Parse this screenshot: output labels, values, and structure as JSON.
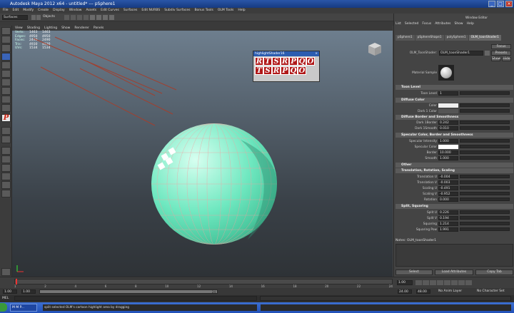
{
  "window": {
    "title": "Autodesk Maya 2012 x64 - untitled*   ---   pSphere1"
  },
  "menu": [
    "File",
    "Edit",
    "Modify",
    "Create",
    "Display",
    "Window",
    "Assets",
    "Edit Curves",
    "Surfaces",
    "Edit NURBS",
    "Subdiv Surfaces",
    "Bonus Tools",
    "OLM Tools",
    "Help"
  ],
  "status": {
    "mode": "Surfaces",
    "objects_label": "Objects"
  },
  "viewport": {
    "menu": [
      "View",
      "Shading",
      "Lighting",
      "Show",
      "Renderer",
      "Panels"
    ],
    "hud": [
      {
        "k": "Verts:",
        "v": "1463",
        "v2": "1463"
      },
      {
        "k": "Edges:",
        "v": "4950",
        "v2": "4950"
      },
      {
        "k": "Faces:",
        "v": "2490",
        "v2": "2490"
      },
      {
        "k": "Tris:",
        "v": "4930",
        "v2": "4930"
      },
      {
        "k": "UVs:",
        "v": "1534",
        "v2": "1534"
      }
    ],
    "axis_label": "persp"
  },
  "highlight_window": {
    "title": "highlightShader16",
    "row1": [
      "R",
      "T",
      "S",
      "R",
      "P",
      "Q",
      "O"
    ],
    "row2": [
      "T",
      "S",
      "R",
      "P",
      "Q",
      "O"
    ]
  },
  "attribute_editor": {
    "menu": [
      "List",
      "Selected",
      "Focus",
      "Attributes",
      "Show",
      "Help"
    ],
    "window_title": "Window Editor",
    "tabs": [
      "pSphere1",
      "pSphereShape1",
      "polySphere1",
      "OLM_toonShader1"
    ],
    "node_label": "OLM_ToonShader:",
    "node_value": "OLM_toonShader1",
    "focus_btn": "Focus",
    "presets_btn": "Presets",
    "show_btn": "Show",
    "hide_btn": "Hide",
    "material_sample": "Material Sample",
    "sections": {
      "toon_level": "Toon Level",
      "toon_level_label": "Toon Level",
      "toon_level_value": "1",
      "diffuse": "Diffuse Color",
      "color_label": "Color",
      "dark_color_label": "Dark 1 Color",
      "border": "Diffuse Border and Smoothness",
      "dark_border_label": "Dark 1Border",
      "dark_border_value": "0.242",
      "dark_smooth_label": "Dark 1Smooth",
      "dark_smooth_value": "0.010",
      "specular": "Specular Color, Border and Smoothness",
      "spec_int_label": "Specular Intensity",
      "spec_int_value": "1.000",
      "spec_color_label": "Specular Color",
      "spec_border_label": "Border",
      "spec_border_value": "10.000",
      "spec_smooth_label": "Smooth",
      "spec_smooth_value": "1.000",
      "other": "Other",
      "trs": "Translation, Rotation, Scaling",
      "tu_label": "Translation U",
      "tu_value": "-0.004",
      "tv_label": "Translation V",
      "tv_value": "-0.003",
      "su_label": "Scaling U",
      "su_value": "-0.491",
      "sv_label": "Scaling V",
      "sv_value": "-0.952",
      "rot_label": "Rotation",
      "rot_value": "0.000",
      "split": "Split, Squaring",
      "splitu_label": "Split U",
      "splitu_value": "0.226",
      "splitv_label": "Split V",
      "splitv_value": "0.194",
      "sq_label": "Squaring",
      "sq_value": "1.214",
      "sqp_label": "Squaring Pow",
      "sqp_value": "1.991",
      "notes": "Notes: OLM_toonShader1"
    },
    "buttons": [
      "Select",
      "Load Attributes",
      "Copy Tab"
    ]
  },
  "timeline": {
    "start": "1",
    "end": "24",
    "ticks": [
      "2",
      "4",
      "6",
      "8",
      "10",
      "12",
      "14",
      "16",
      "18",
      "20",
      "22",
      "24"
    ],
    "current": "1.00"
  },
  "range": {
    "start": "1.00",
    "inner_start": "1.00",
    "inner_end": "24",
    "end_a": "24.00",
    "end_b": "48.00",
    "anim_layer": "No Anim Layer",
    "char_set": "No Character Set"
  },
  "cmd": {
    "label": "MEL"
  },
  "help_line": "split selected OLM's cartoon highlight area by dragging",
  "taskbar": {
    "start": "",
    "app": "M M P..."
  },
  "colors": {
    "sphere": "#5ee8b8",
    "grid_line": "#f2a0a0",
    "title_blue": "#2a56a8"
  }
}
